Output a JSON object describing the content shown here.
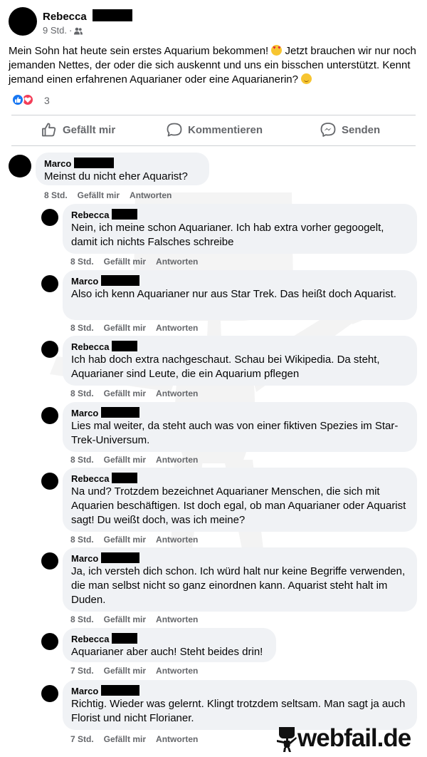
{
  "post": {
    "author": "Rebecca",
    "meta_time": "9 Std.",
    "meta_separator": "·",
    "text_part1": "Mein Sohn hat heute sein erstes Aquarium bekommen! ",
    "text_part2": " Jetzt brauchen wir nur noch jemanden Nettes, der oder die sich auskennt und uns ein bisschen unterstützt. Kennt jemand einen erfahrenen Aquarianer oder eine Aquarianerin? ",
    "reaction_count": "3"
  },
  "actions": {
    "like_label": "Gefällt mir",
    "comment_label": "Kommentieren",
    "send_label": "Senden"
  },
  "comments": [
    {
      "name": "Marco",
      "text": "Meinst du nicht eher Aquarist?",
      "time": "8 Std.",
      "like": "Gefällt mir",
      "reply": "Antworten"
    },
    {
      "name": "Rebecca",
      "text": "Nein, ich meine schon Aquarianer. Ich hab extra vorher gegoogelt, damit ich nichts Falsches schreibe",
      "time": "8 Std.",
      "like": "Gefällt mir",
      "reply": "Antworten"
    },
    {
      "name": "Marco",
      "text": "Also ich kenn Aquarianer nur aus Star Trek. Das heißt doch Aquarist.",
      "time": "8 Std.",
      "like": "Gefällt mir",
      "reply": "Antworten"
    },
    {
      "name": "Rebecca",
      "text": "Ich hab doch extra nachgeschaut. Schau bei Wikipedia. Da steht, Aquarianer sind Leute, die ein Aquarium pflegen",
      "time": "8 Std.",
      "like": "Gefällt mir",
      "reply": "Antworten"
    },
    {
      "name": "Marco",
      "text": "Lies mal weiter, da steht auch was von einer fiktiven Spezies im Star-Trek-Universum.",
      "time": "8 Std.",
      "like": "Gefällt mir",
      "reply": "Antworten"
    },
    {
      "name": "Rebecca",
      "text": "Na und? Trotzdem bezeichnet Aquarianer Menschen, die sich mit Aquarien beschäftigen. Ist doch egal, ob man Aquarianer oder Aquarist sagt! Du weißt doch, was ich meine?",
      "time": "8 Std.",
      "like": "Gefällt mir",
      "reply": "Antworten"
    },
    {
      "name": "Marco",
      "text": "Ja, ich versteh dich schon. Ich würd halt nur keine Begriffe verwenden, die man selbst nicht so ganz einordnen kann. Aquarist steht halt im Duden.",
      "time": "8 Std.",
      "like": "Gefällt mir",
      "reply": "Antworten"
    },
    {
      "name": "Rebecca",
      "text": "Aquarianer aber auch! Steht beides drin!",
      "time": "7 Std.",
      "like": "Gefällt mir",
      "reply": "Antworten"
    },
    {
      "name": "Marco",
      "text": "Richtig. Wieder was gelernt. Klingt trotzdem seltsam. Man sagt ja auch Florist und nicht Florianer.",
      "time": "7 Std.",
      "like": "Gefällt mir",
      "reply": "Antworten"
    }
  ],
  "logo": {
    "text": "webfail.de"
  },
  "icons": {
    "audience": "people-icon",
    "like": "thumbs-up-icon",
    "comment": "speech-bubble-icon",
    "send": "messenger-icon",
    "reaction_like": "like-reaction-icon",
    "reaction_love": "love-reaction-icon",
    "emoji1": "heart-eyes-emoji-icon",
    "emoji2": "smile-emoji-icon"
  },
  "colors": {
    "like_blue": "#1877f2",
    "love_red": "#f33e58",
    "bubble_bg": "#f0f2f5",
    "meta_gray": "#65676b"
  }
}
